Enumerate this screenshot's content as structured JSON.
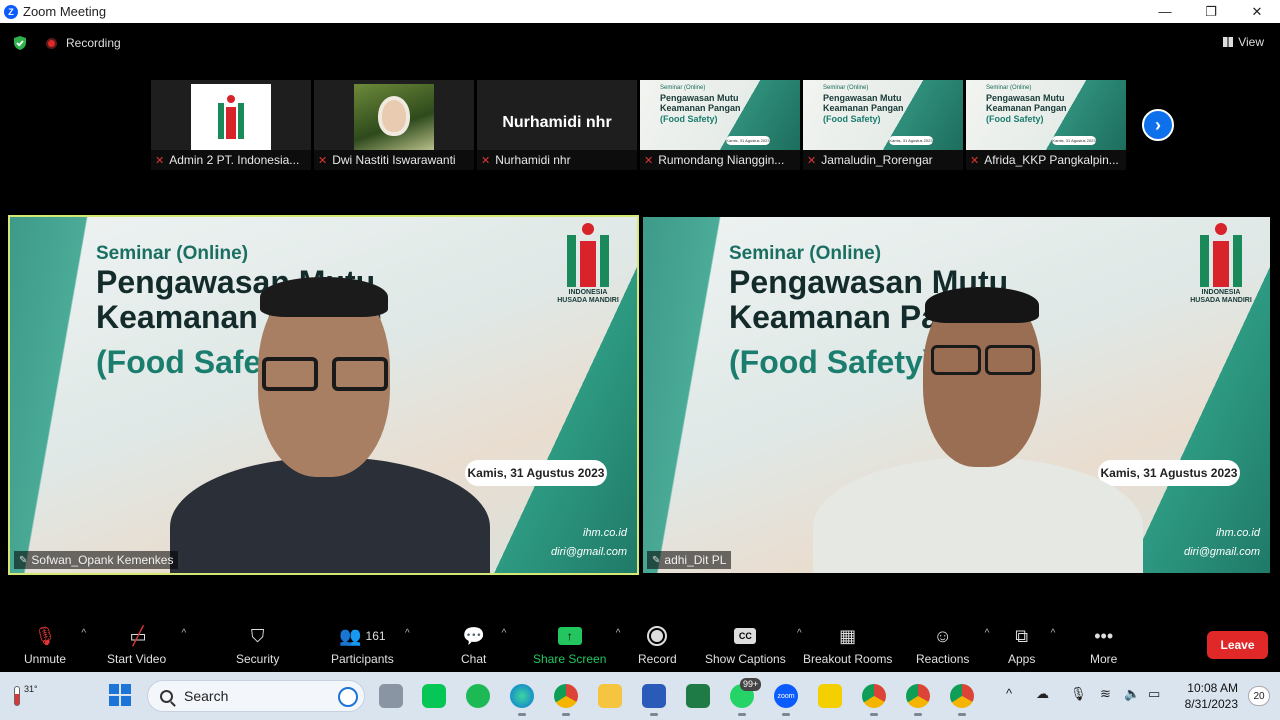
{
  "window": {
    "title": "Zoom Meeting",
    "minimize": "—",
    "restore": "❐",
    "close": "✕"
  },
  "status": {
    "recording_label": "Recording",
    "view_label": "View"
  },
  "thumbnails": [
    {
      "name": "Admin 2 PT. Indonesia...",
      "kind": "logo",
      "logo_text": "INDONESIA"
    },
    {
      "name": "Dwi Nastiti Iswarawanti",
      "kind": "photo"
    },
    {
      "name": "Nurhamidi nhr",
      "kind": "text",
      "display": "Nurhamidi nhr"
    },
    {
      "name": "Rumondang Nianggin...",
      "kind": "slide"
    },
    {
      "name": "Jamaludin_Rorengar",
      "kind": "slide"
    },
    {
      "name": "Afrida_KKP Pangkalpin...",
      "kind": "slide"
    }
  ],
  "mini_slide": {
    "sub": "Seminar (Online)",
    "title_line1": "Pengawasan Mutu",
    "title_line2": "Keamanan Pangan",
    "fs": "(Food Safety)",
    "date": "Kamis, 31 Agustus 2023"
  },
  "slide": {
    "sub": "Seminar (Online)",
    "title_line1": "Pengawasan Mutu",
    "title_line2": "Keamanan Pangan",
    "fs": "(Food Safety)",
    "date": "Kamis, 31 Agustus 2023",
    "web": "ihm.co.id",
    "mail": "diri@gmail.com",
    "logo_line1": "INDONESIA",
    "logo_line2": "HUSADA MANDIRI"
  },
  "videos": [
    {
      "name": "Sofwan_Opank Kemenkes",
      "active": true
    },
    {
      "name": "adhi_Dit PL",
      "active": false
    }
  ],
  "toolbar": {
    "unmute": "Unmute",
    "start_video": "Start Video",
    "security": "Security",
    "participants": "Participants",
    "participant_count": "161",
    "chat": "Chat",
    "share_screen": "Share Screen",
    "record": "Record",
    "show_captions": "Show Captions",
    "cc": "CC",
    "breakout_rooms": "Breakout Rooms",
    "reactions": "Reactions",
    "apps": "Apps",
    "more": "More",
    "leave": "Leave"
  },
  "taskbar": {
    "temperature": "31°",
    "search_label": "Search",
    "whatsapp_badge": "99+",
    "zoom_label": "zoom",
    "time": "10:08 AM",
    "date": "8/31/2023",
    "notification_count": "20"
  },
  "colors": {
    "accent_blue": "#0e71eb",
    "share_green": "#22c55e",
    "leave_red": "#e02828",
    "active_outline": "#d6e874",
    "teal": "#1b7d6e"
  }
}
